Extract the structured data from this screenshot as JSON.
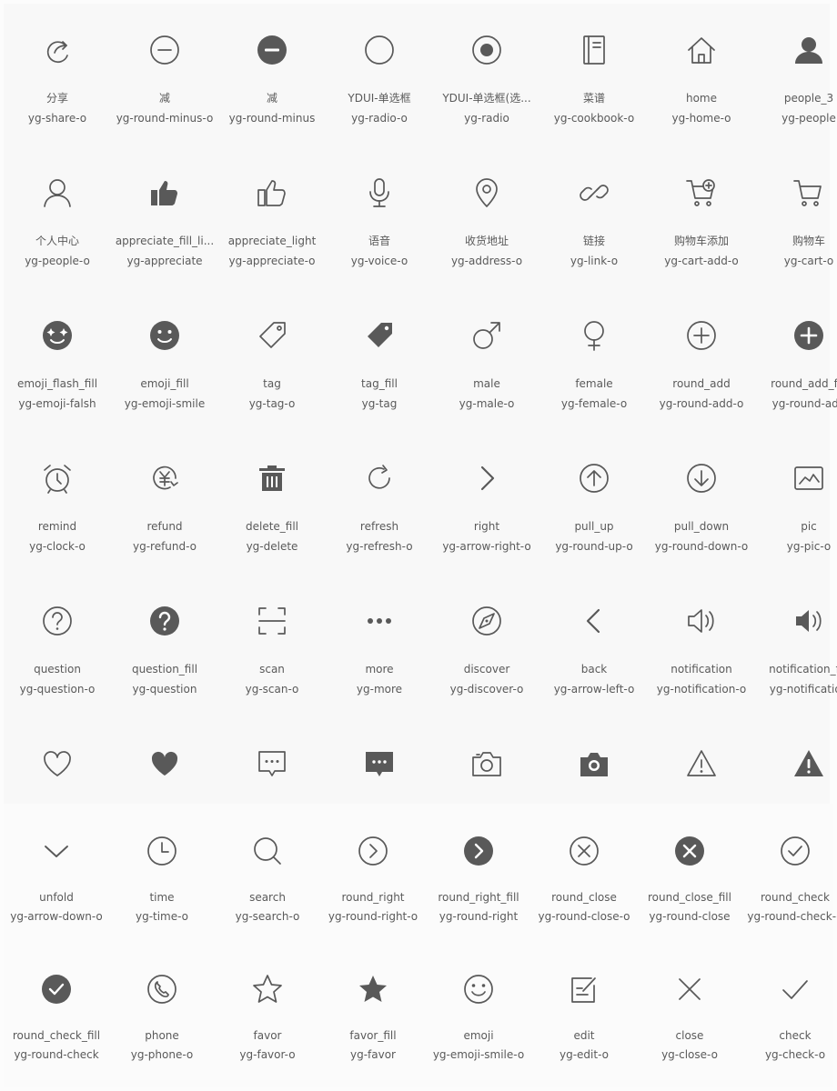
{
  "sections": [
    {
      "items": [
        {
          "name": "分享",
          "code": "yg-share-o",
          "icon": "share-icon"
        },
        {
          "name": "减",
          "code": "yg-round-minus-o",
          "icon": "round-minus-outline-icon"
        },
        {
          "name": "减",
          "code": "yg-round-minus",
          "icon": "round-minus-fill-icon"
        },
        {
          "name": "YDUI-单选框",
          "code": "yg-radio-o",
          "icon": "radio-outline-icon"
        },
        {
          "name": "YDUI-单选框(选...",
          "code": "yg-radio",
          "icon": "radio-checked-icon"
        },
        {
          "name": "菜谱",
          "code": "yg-cookbook-o",
          "icon": "cookbook-icon"
        },
        {
          "name": "home",
          "code": "yg-home-o",
          "icon": "home-icon"
        },
        {
          "name": "people_3",
          "code": "yg-people",
          "icon": "people-fill-icon"
        },
        {
          "name": "个人中心",
          "code": "yg-people-o",
          "icon": "people-outline-icon"
        },
        {
          "name": "appreciate_fill_li...",
          "code": "yg-appreciate",
          "icon": "thumbs-up-fill-icon"
        },
        {
          "name": "appreciate_light",
          "code": "yg-appreciate-o",
          "icon": "thumbs-up-outline-icon"
        },
        {
          "name": "语音",
          "code": "yg-voice-o",
          "icon": "microphone-icon"
        },
        {
          "name": "收货地址",
          "code": "yg-address-o",
          "icon": "location-pin-icon"
        },
        {
          "name": "链接",
          "code": "yg-link-o",
          "icon": "link-icon"
        },
        {
          "name": "购物车添加",
          "code": "yg-cart-add-o",
          "icon": "cart-add-icon"
        },
        {
          "name": "购物车",
          "code": "yg-cart-o",
          "icon": "cart-icon"
        },
        {
          "name": "emoji_flash_fill",
          "code": "yg-emoji-falsh",
          "icon": "emoji-flash-fill-icon"
        },
        {
          "name": "emoji_fill",
          "code": "yg-emoji-smile",
          "icon": "emoji-smile-fill-icon"
        },
        {
          "name": "tag",
          "code": "yg-tag-o",
          "icon": "tag-outline-icon"
        },
        {
          "name": "tag_fill",
          "code": "yg-tag",
          "icon": "tag-fill-icon"
        },
        {
          "name": "male",
          "code": "yg-male-o",
          "icon": "male-icon"
        },
        {
          "name": "female",
          "code": "yg-female-o",
          "icon": "female-icon"
        },
        {
          "name": "round_add",
          "code": "yg-round-add-o",
          "icon": "round-add-outline-icon"
        },
        {
          "name": "round_add_fill",
          "code": "yg-round-add",
          "icon": "round-add-fill-icon"
        },
        {
          "name": "remind",
          "code": "yg-clock-o",
          "icon": "alarm-clock-icon"
        },
        {
          "name": "refund",
          "code": "yg-refund-o",
          "icon": "refund-icon"
        },
        {
          "name": "delete_fill",
          "code": "yg-delete",
          "icon": "trash-fill-icon"
        },
        {
          "name": "refresh",
          "code": "yg-refresh-o",
          "icon": "refresh-icon"
        },
        {
          "name": "right",
          "code": "yg-arrow-right-o",
          "icon": "chevron-right-icon"
        },
        {
          "name": "pull_up",
          "code": "yg-round-up-o",
          "icon": "round-arrow-up-icon"
        },
        {
          "name": "pull_down",
          "code": "yg-round-down-o",
          "icon": "round-arrow-down-icon"
        },
        {
          "name": "pic",
          "code": "yg-pic-o",
          "icon": "picture-icon"
        },
        {
          "name": "question",
          "code": "yg-question-o",
          "icon": "question-outline-icon"
        },
        {
          "name": "question_fill",
          "code": "yg-question",
          "icon": "question-fill-icon"
        },
        {
          "name": "scan",
          "code": "yg-scan-o",
          "icon": "scan-icon"
        },
        {
          "name": "more",
          "code": "yg-more",
          "icon": "more-dots-icon"
        },
        {
          "name": "discover",
          "code": "yg-discover-o",
          "icon": "discover-icon"
        },
        {
          "name": "back",
          "code": "yg-arrow-left-o",
          "icon": "chevron-left-icon"
        },
        {
          "name": "notification",
          "code": "yg-notification-o",
          "icon": "speaker-outline-icon"
        },
        {
          "name": "notification_fill",
          "code": "yg-notification",
          "icon": "speaker-fill-icon"
        },
        {
          "name": "",
          "code": "",
          "icon": "heart-outline-icon"
        },
        {
          "name": "",
          "code": "",
          "icon": "heart-fill-icon"
        },
        {
          "name": "",
          "code": "",
          "icon": "message-outline-icon"
        },
        {
          "name": "",
          "code": "",
          "icon": "message-fill-icon"
        },
        {
          "name": "",
          "code": "",
          "icon": "camera-outline-icon"
        },
        {
          "name": "",
          "code": "",
          "icon": "camera-fill-icon"
        },
        {
          "name": "",
          "code": "",
          "icon": "warning-outline-icon"
        },
        {
          "name": "",
          "code": "",
          "icon": "warning-fill-icon"
        }
      ]
    },
    {
      "items": [
        {
          "name": "unfold",
          "code": "yg-arrow-down-o",
          "icon": "chevron-down-icon"
        },
        {
          "name": "time",
          "code": "yg-time-o",
          "icon": "clock-icon"
        },
        {
          "name": "search",
          "code": "yg-search-o",
          "icon": "search-icon"
        },
        {
          "name": "round_right",
          "code": "yg-round-right-o",
          "icon": "round-right-outline-icon"
        },
        {
          "name": "round_right_fill",
          "code": "yg-round-right",
          "icon": "round-right-fill-icon"
        },
        {
          "name": "round_close",
          "code": "yg-round-close-o",
          "icon": "round-close-outline-icon"
        },
        {
          "name": "round_close_fill",
          "code": "yg-round-close",
          "icon": "round-close-fill-icon"
        },
        {
          "name": "round_check",
          "code": "yg-round-check-o",
          "icon": "round-check-outline-icon"
        },
        {
          "name": "round_check_fill",
          "code": "yg-round-check",
          "icon": "round-check-fill-icon"
        },
        {
          "name": "phone",
          "code": "yg-phone-o",
          "icon": "phone-icon"
        },
        {
          "name": "favor",
          "code": "yg-favor-o",
          "icon": "star-outline-icon"
        },
        {
          "name": "favor_fill",
          "code": "yg-favor",
          "icon": "star-fill-icon"
        },
        {
          "name": "emoji",
          "code": "yg-emoji-smile-o",
          "icon": "emoji-outline-icon"
        },
        {
          "name": "edit",
          "code": "yg-edit-o",
          "icon": "edit-icon"
        },
        {
          "name": "close",
          "code": "yg-close-o",
          "icon": "close-icon"
        },
        {
          "name": "check",
          "code": "yg-check-o",
          "icon": "check-icon"
        }
      ]
    }
  ],
  "colors": {
    "icon": "#595959",
    "text": "#5a5a5a",
    "page_bg": "#fcfcfc",
    "panel_bg": "#f8f8f8"
  }
}
